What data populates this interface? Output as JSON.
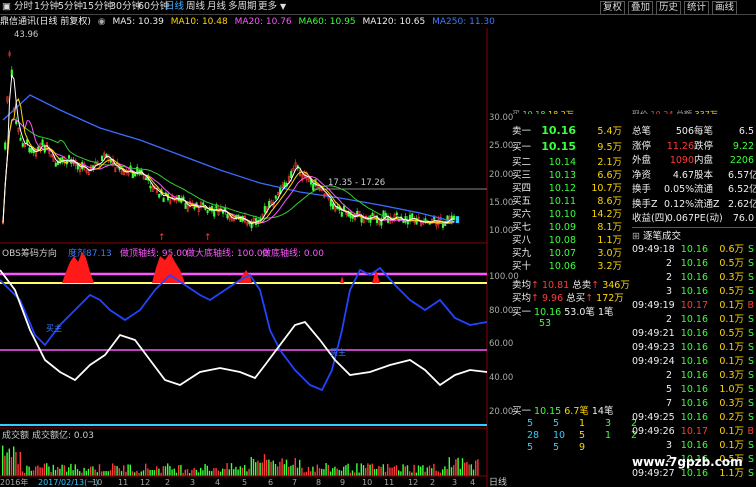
{
  "toolbar": {
    "items": [
      "分时",
      "1分钟",
      "5分钟",
      "15分钟",
      "30分钟",
      "60分钟",
      "日线",
      "周线",
      "月线",
      "多周期",
      "更多"
    ],
    "active": "日线",
    "right_items": [
      "复权",
      "叠加",
      "历史",
      "统计",
      "画线"
    ]
  },
  "stock": {
    "name": "鼎信通讯(日线 前复权)",
    "ma5": "MA5: 10.39",
    "ma10": "MA10: 10.48",
    "ma20": "MA20: 10.76",
    "ma60": "MA60: 10.95",
    "ma120": "MA120: 10.65",
    "ma250": "MA250: 11.30",
    "high_label": "43.96",
    "range_label": "17.35 - 17.26"
  },
  "price_axis": [
    "30.00",
    "25.00",
    "20.00",
    "15.00",
    "10.00"
  ],
  "obs": {
    "title": "OBS筹码方向",
    "a": "度剂",
    "b": "87.13",
    "c": "做顶轴线: 95.00",
    "d": "做大底轴线: 100.00",
    "e": "做底轴线: 0.00",
    "axis": [
      "100.00",
      "80.00",
      "60.00",
      "40.00",
      "20.00"
    ]
  },
  "volume": {
    "title": "成交额",
    "value": "成交额亿: 0.03",
    "date_axis": [
      "2016年",
      "2017/02/13(一)",
      "10",
      "11",
      "12",
      "2",
      "3",
      "4",
      "5",
      "6",
      "7",
      "8",
      "9",
      "10",
      "11",
      "12",
      "2",
      "3",
      "4"
    ],
    "period": "日线"
  },
  "quote": {
    "top": [
      {
        "label": "卖一",
        "price": "10.16",
        "vol": "5.4万"
      },
      {
        "label": "买一",
        "price": "10.15",
        "vol": "9.5万"
      },
      {
        "label": "买二",
        "price": "10.14",
        "vol": "2.1万"
      },
      {
        "label": "买三",
        "price": "10.13",
        "vol": "6.6万"
      },
      {
        "label": "买四",
        "price": "10.12",
        "vol": "10.7万"
      },
      {
        "label": "买五",
        "price": "10.11",
        "vol": "8.6万"
      },
      {
        "label": "买六",
        "price": "10.10",
        "vol": "14.2万"
      },
      {
        "label": "买七",
        "price": "10.09",
        "vol": "8.1万"
      },
      {
        "label": "买八",
        "price": "10.08",
        "vol": "1.1万"
      },
      {
        "label": "买九",
        "price": "10.07",
        "vol": "3.0万"
      },
      {
        "label": "买十",
        "price": "10.06",
        "vol": "3.2万"
      }
    ],
    "top_cut": {
      "label": "买",
      "price": "10.18",
      "vol": "18.2万"
    },
    "avg_sell": {
      "label": "卖均",
      "price": "10.81",
      "tlabel": "总卖",
      "tval": "346万"
    },
    "avg_buy": {
      "label": "买均",
      "price": "9.96",
      "tlabel": "总买",
      "tval": "172万"
    },
    "trade1": {
      "label": "买一",
      "price": "10.16",
      "vol": "53.0笔",
      "count": "1笔",
      "extra": "53"
    },
    "trade2": {
      "label": "买一",
      "price": "10.15",
      "vol": "6.7笔",
      "count": "14笔"
    },
    "grid": [
      [
        "5",
        "5",
        "1",
        "3",
        "2"
      ],
      [
        "28",
        "10",
        "5",
        "1",
        "2"
      ],
      [
        "5",
        "5",
        "9",
        "",
        ""
      ]
    ],
    "stats": [
      {
        "l1": "总笔",
        "v1": "506",
        "l2": "每笔",
        "v2": "6.5"
      },
      {
        "l1": "涨停",
        "v1": "11.26",
        "l2": "跌停",
        "v2": "9.22"
      },
      {
        "l1": "外盘",
        "v1": "1090",
        "l2": "内盘",
        "v2": "2206"
      },
      {
        "l1": "净资",
        "v1": "4.67",
        "l2": "股本",
        "v2": "6.57亿"
      },
      {
        "l1": "换手",
        "v1": "0.05%",
        "l2": "流通",
        "v2": "6.52亿"
      },
      {
        "l1": "换手Z",
        "v1": "0.12%",
        "l2": "流通Z",
        "v2": "2.62亿"
      },
      {
        "l1": "收益(四)",
        "v1": "0.067",
        "l2": "PE(动)",
        "v2": "76.0"
      }
    ],
    "stats_cut": {
      "l1": "现价",
      "v1": "10.24",
      "l2": "总额",
      "v2": "337万"
    },
    "ticks_title": "逐笔成交",
    "ticks": [
      {
        "t": "09:49:18",
        "p": "10.16",
        "v": "0.6万",
        "f": "S"
      },
      {
        "t": "2",
        "p": "10.16",
        "v": "0.5万",
        "f": "S"
      },
      {
        "t": "2",
        "p": "10.16",
        "v": "0.3万",
        "f": "S"
      },
      {
        "t": "3",
        "p": "10.16",
        "v": "0.5万",
        "f": "S"
      },
      {
        "t": "09:49:19",
        "p": "10.17",
        "v": "0.1万",
        "f": "B"
      },
      {
        "t": "2",
        "p": "10.16",
        "v": "0.1万",
        "f": "S"
      },
      {
        "t": "09:49:21",
        "p": "10.16",
        "v": "0.5万",
        "f": "S"
      },
      {
        "t": "09:49:23",
        "p": "10.16",
        "v": "0.1万",
        "f": "S"
      },
      {
        "t": "09:49:24",
        "p": "10.16",
        "v": "0.1万",
        "f": "S"
      },
      {
        "t": "2",
        "p": "10.16",
        "v": "0.3万",
        "f": "S"
      },
      {
        "t": "5",
        "p": "10.16",
        "v": "1.0万",
        "f": "S"
      },
      {
        "t": "7",
        "p": "10.16",
        "v": "0.3万",
        "f": "S"
      },
      {
        "t": "09:49:25",
        "p": "10.16",
        "v": "0.2万",
        "f": "S"
      },
      {
        "t": "09:49:26",
        "p": "10.17",
        "v": "0.1万",
        "f": "B"
      },
      {
        "t": "3",
        "p": "10.16",
        "v": "0.1万",
        "f": "S"
      },
      {
        "t": "2",
        "p": "10.16",
        "v": "0.5万",
        "f": "S"
      },
      {
        "t": "09:49:27",
        "p": "10.16",
        "v": "1.1万",
        "f": "S"
      }
    ]
  },
  "watermark": "www.7gpzb.com",
  "colors": {
    "up": "#ff3b3b",
    "down": "#3cff3c",
    "ma5": "#ffffff",
    "ma10": "#ffd700",
    "ma20": "#ff55ff",
    "ma60": "#3cff3c",
    "ma250": "#3070ff"
  }
}
